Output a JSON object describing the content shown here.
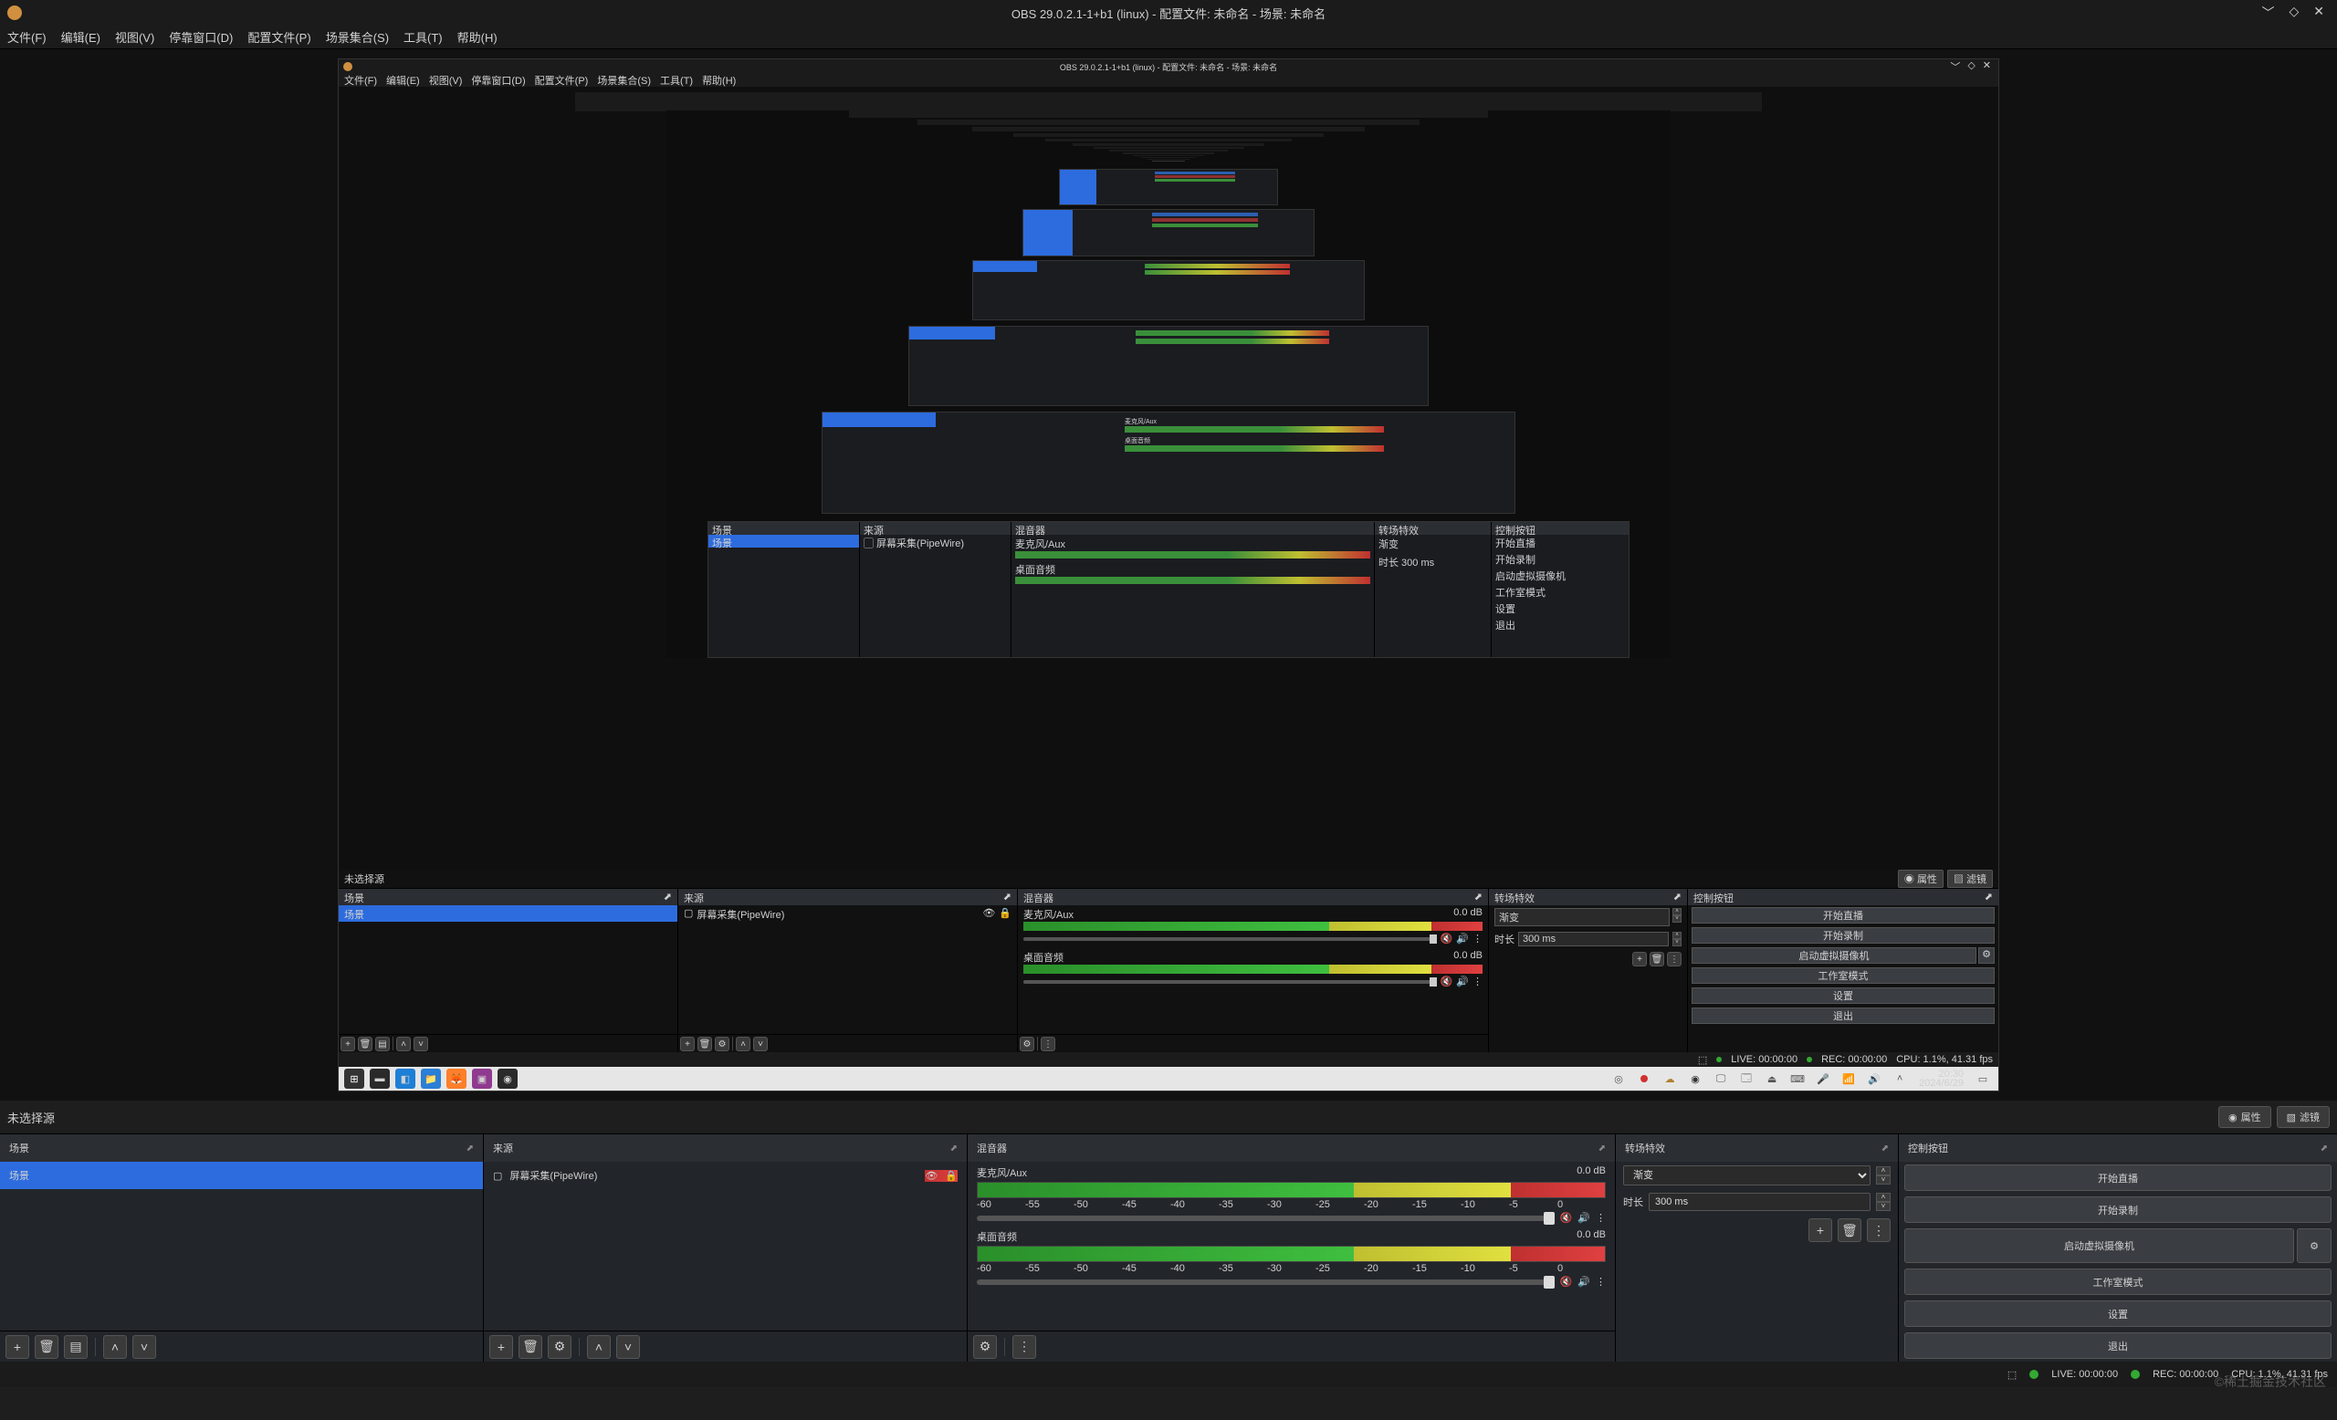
{
  "window": {
    "title": "OBS 29.0.2.1-1+b1 (linux) - 配置文件: 未命名 - 场景: 未命名"
  },
  "menu": {
    "file": "文件(F)",
    "edit": "编辑(E)",
    "view": "视图(V)",
    "dock": "停靠窗口(D)",
    "profile": "配置文件(P)",
    "scenecol": "场景集合(S)",
    "tools": "工具(T)",
    "help": "帮助(H)"
  },
  "nosel": {
    "label": "未选择源",
    "props": "属性",
    "filters": "滤镜"
  },
  "docks": {
    "scenes": {
      "title": "场景",
      "item": "场景"
    },
    "sources": {
      "title": "来源",
      "item": "屏幕采集(PipeWire)"
    },
    "mixer": {
      "title": "混音器",
      "mic": {
        "name": "麦克风/Aux",
        "db": "0.0 dB"
      },
      "desk": {
        "name": "桌面音频",
        "db": "0.0 dB"
      },
      "ticks": [
        "-60",
        "-55",
        "-50",
        "-45",
        "-40",
        "-35",
        "-30",
        "-25",
        "-20",
        "-15",
        "-10",
        "-5",
        "0"
      ]
    },
    "trans": {
      "title": "转场特效",
      "type": "渐变",
      "durlabel": "时长",
      "dur": "300 ms"
    },
    "ctrl": {
      "title": "控制按钮",
      "stream": "开始直播",
      "record": "开始录制",
      "vcam": "启动虚拟摄像机",
      "studio": "工作室模式",
      "settings": "设置",
      "exit": "退出"
    }
  },
  "status": {
    "live": "LIVE: 00:00:00",
    "rec": "REC: 00:00:00",
    "cpu": "CPU: 1.1%, 41.31 fps"
  },
  "nested": {
    "status": {
      "live": "LIVE: 00:00:00",
      "rec": "REC: 00:00:00",
      "cpu": "CPU: 1.1%, 41.31 fps"
    },
    "clock": {
      "time": "20:30",
      "date": "2024/6/29"
    }
  },
  "watermark": "©稀土掘金技术社区"
}
